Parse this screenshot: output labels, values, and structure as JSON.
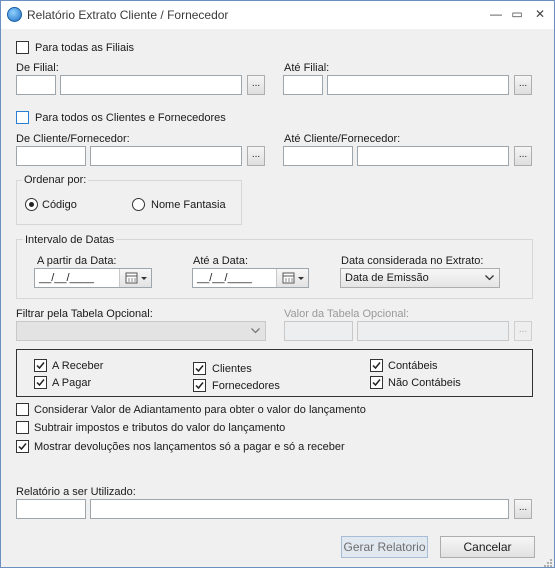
{
  "window": {
    "title": "Relatório Extrato Cliente / Fornecedor",
    "minimize": "—",
    "maximize": "▭",
    "close": "✕"
  },
  "filial": {
    "all_label": "Para todas as Filiais",
    "from_label": "De Filial:",
    "to_label": "Até Filial:",
    "from_code": "",
    "from_name": "",
    "to_code": "",
    "to_name": "",
    "browse": "..."
  },
  "cliente": {
    "all_label": "Para todos os Clientes e Fornecedores",
    "from_label": "De Cliente/Fornecedor:",
    "to_label": "Até Cliente/Fornecedor:",
    "from_code": "",
    "from_name": "",
    "to_code": "",
    "to_name": "",
    "browse": "..."
  },
  "ordenar": {
    "title": "Ordenar por:",
    "options": [
      "Código",
      "Nome Fantasia"
    ],
    "selected": "Código"
  },
  "datas": {
    "title": "Intervalo de Datas",
    "start_label": "A partir da Data:",
    "start_value": "__/__/____",
    "end_label": "Até a Data:",
    "end_value": "__/__/____",
    "considered_label": "Data considerada no Extrato:",
    "considered_value": "Data de Emissão"
  },
  "tabela": {
    "filter_label": "Filtrar pela Tabela Opcional:",
    "filter_value": "",
    "value_label": "Valor da Tabela Opcional:",
    "browse": "..."
  },
  "tipos": {
    "receber": "A Receber",
    "pagar": "A Pagar",
    "clientes": "Clientes",
    "fornecedores": "Fornecedores",
    "contabeis": "Contábeis",
    "nao_contabeis": "Não Contábeis"
  },
  "opcoes": {
    "adiantamento": "Considerar Valor de Adiantamento para obter o valor do lançamento",
    "impostos": "Subtrair impostos e tributos do valor do lançamento",
    "devolucoes": "Mostrar devoluções nos lançamentos só a pagar e só a receber"
  },
  "relatorio": {
    "label": "Relatório a ser Utilizado:",
    "code": "",
    "name": "",
    "browse": "..."
  },
  "actions": {
    "generate": "Gerar Relatorio",
    "cancel": "Cancelar"
  }
}
